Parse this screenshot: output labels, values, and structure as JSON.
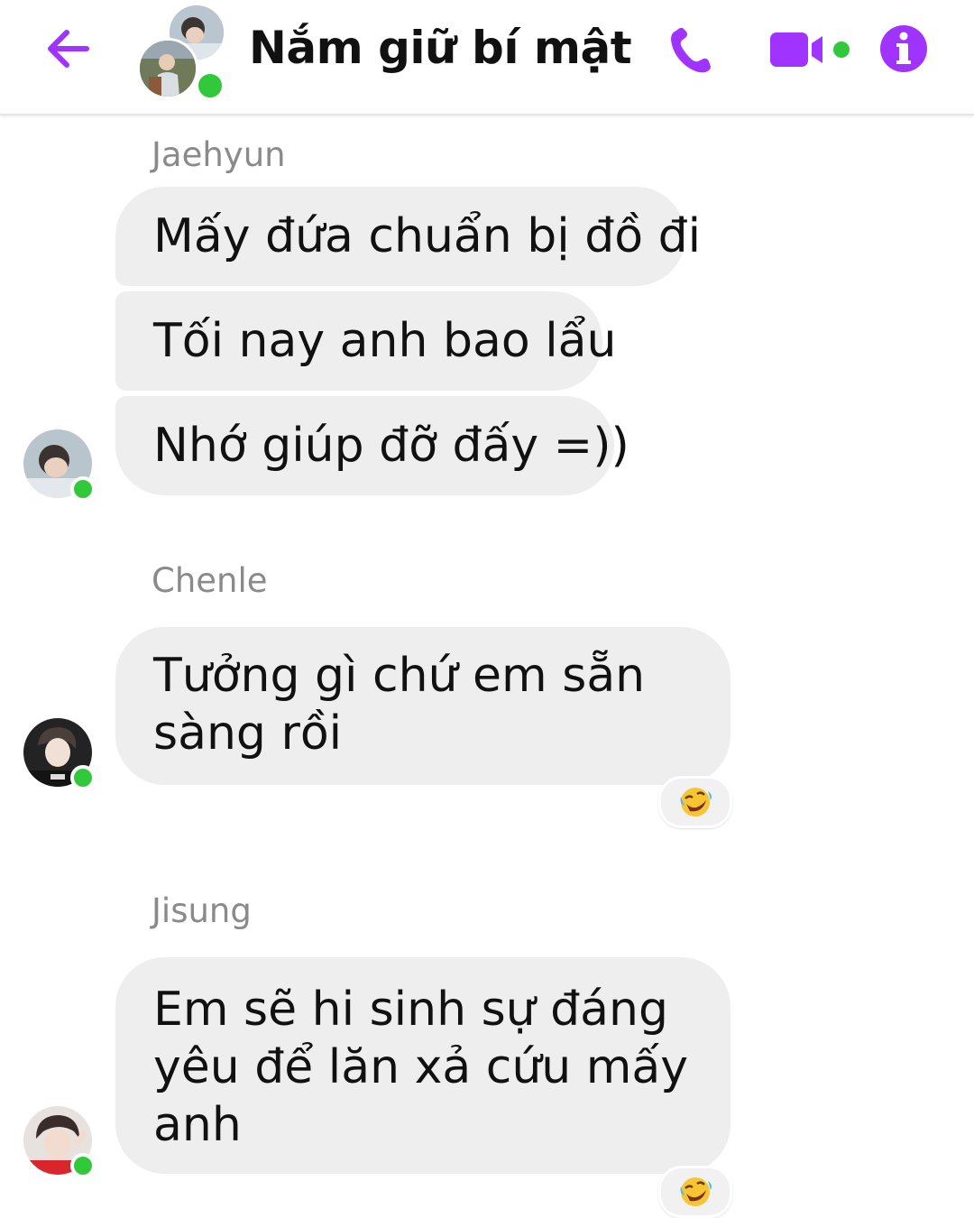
{
  "header": {
    "title": "Nắm giữ bí mật",
    "back_icon": "arrow-left-icon",
    "call_icon": "phone-icon",
    "video_icon": "video-camera-icon",
    "info_icon": "info-icon",
    "accent_color": "#a033ff",
    "online_color": "#31c93b"
  },
  "messages": [
    {
      "sender": "Jaehyun",
      "texts": [
        "Mấy đứa chuẩn bị đồ đi",
        "Tối nay anh bao lẩu",
        "Nhớ giúp đỡ đấy =))"
      ]
    },
    {
      "sender": "Chenle",
      "lines": [
        "Tưởng gì chứ em sẵn",
        "sàng rồi"
      ],
      "reaction": "laughing-crying-emoji"
    },
    {
      "sender": "Jisung",
      "lines": [
        "Em sẽ hi sinh sự đáng",
        "yêu để lăn xả cứu mấy",
        "anh"
      ],
      "reaction": "laughing-crying-emoji"
    }
  ]
}
